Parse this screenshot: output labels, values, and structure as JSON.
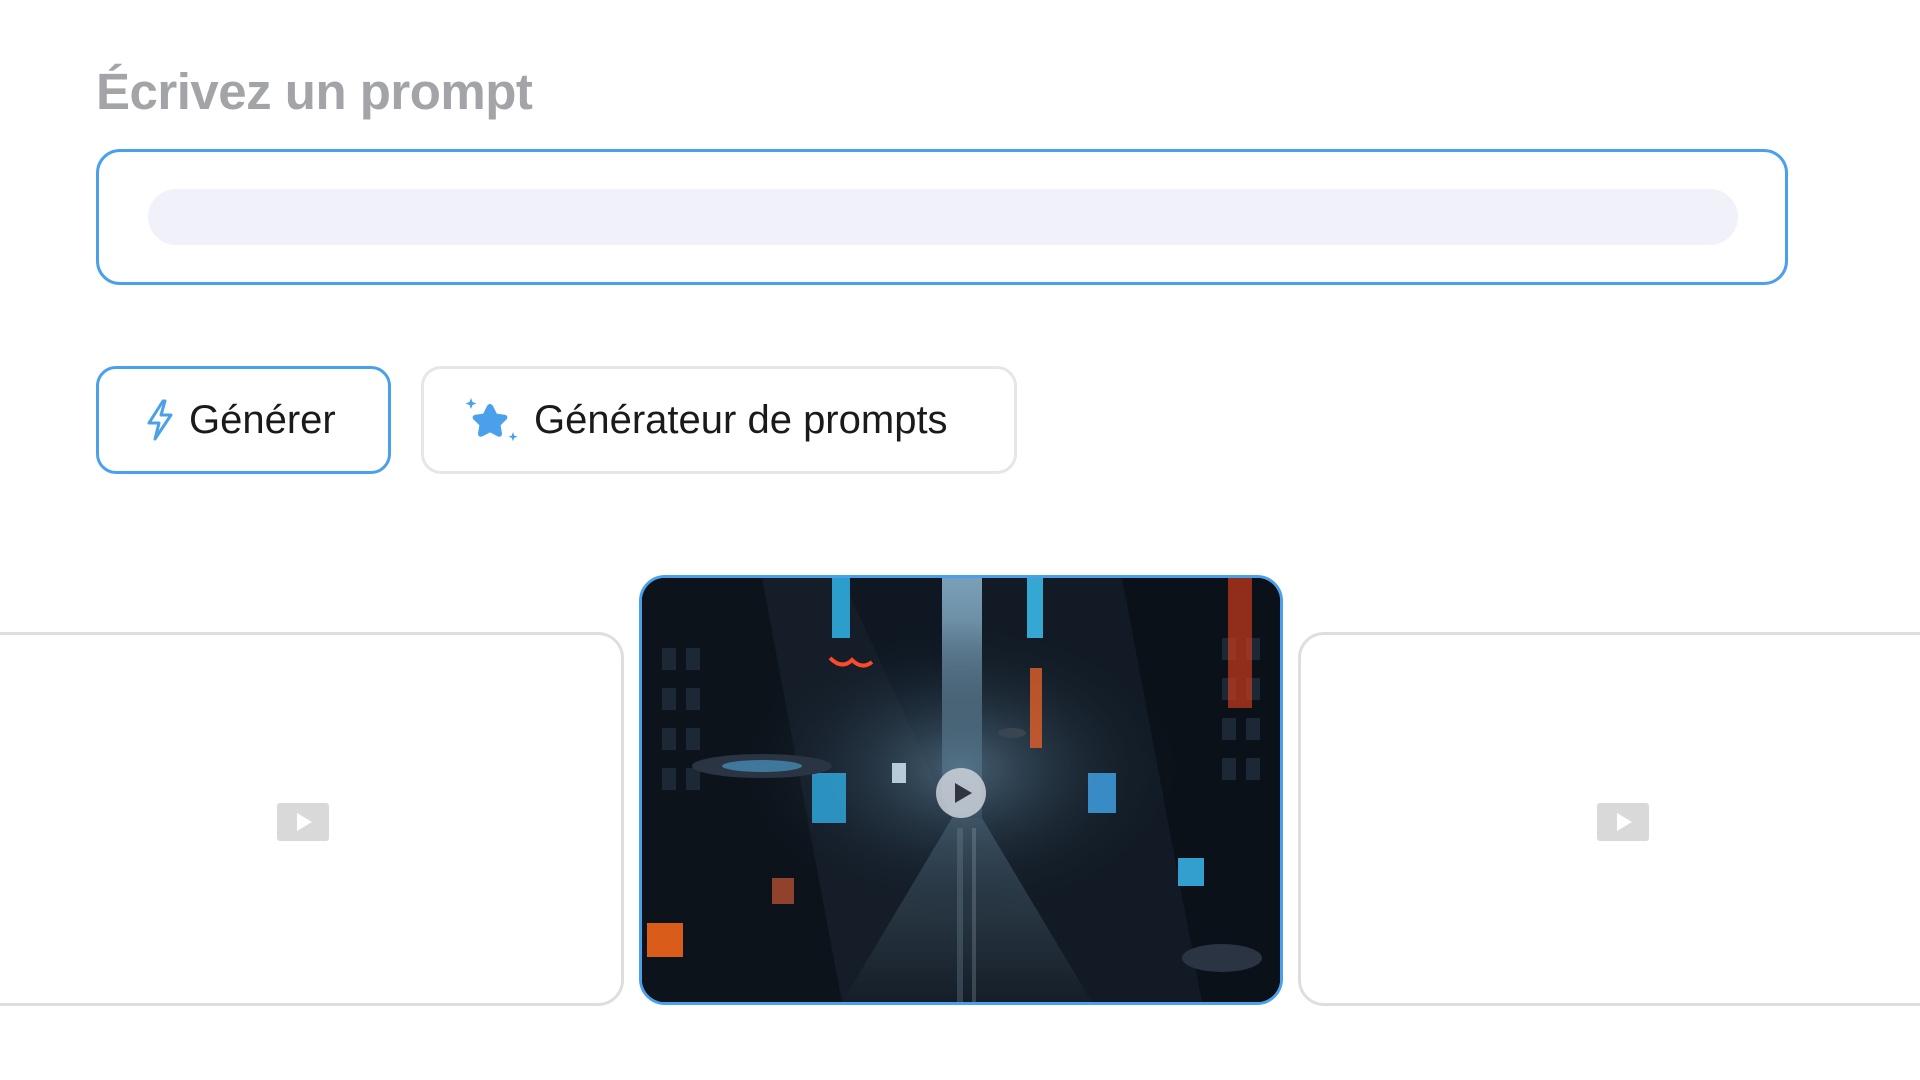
{
  "prompt": {
    "title": "Écrivez un prompt",
    "value": "",
    "placeholder": ""
  },
  "actions": {
    "generate_label": "Générer",
    "prompt_generator_label": "Générateur de prompts"
  },
  "carousel": {
    "items": [
      {
        "state": "placeholder",
        "icon": "video-placeholder-icon"
      },
      {
        "state": "selected",
        "icon": "play-icon"
      },
      {
        "state": "placeholder",
        "icon": "video-placeholder-icon"
      }
    ]
  },
  "colors": {
    "accent": "#4aa0ea",
    "title_gray": "#a3a4a8",
    "input_fill": "#f1f2f9",
    "card_border": "#dedede"
  }
}
